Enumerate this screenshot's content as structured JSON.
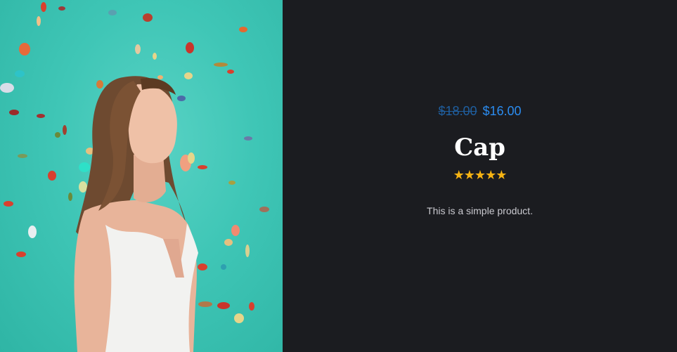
{
  "product": {
    "image_alt": "Woman standing among falling confetti",
    "price_regular": "$18.00",
    "price_sale": "$16.00",
    "title": "Cap",
    "rating": 5,
    "rating_stars": "★★★★★",
    "description": "This is a simple product."
  },
  "colors": {
    "background": "#1b1c20",
    "image_backdrop": "#3fc6b6",
    "price_sale": "#2b8cf0",
    "price_regular": "#1f5fa0",
    "stars": "#f6b313",
    "title": "#ffffff"
  }
}
